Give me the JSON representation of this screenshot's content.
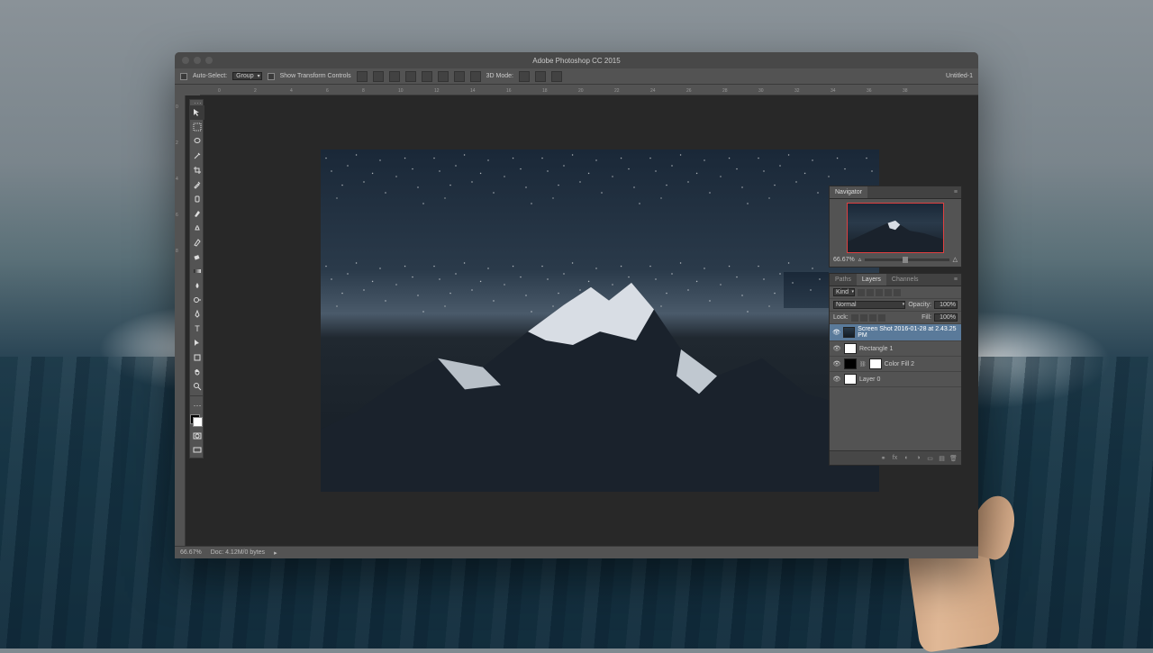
{
  "window": {
    "title": "Adobe Photoshop CC 2015",
    "doc_title": "Untitled-1"
  },
  "options": {
    "auto_select_label": "Auto-Select:",
    "auto_select_value": "Group",
    "show_transform_label": "Show Transform Controls",
    "mode_label": "3D Mode:"
  },
  "navigator": {
    "tab": "Navigator",
    "zoom": "66.67%"
  },
  "layers_panel": {
    "tabs": {
      "paths": "Paths",
      "layers": "Layers",
      "channels": "Channels"
    },
    "kind_label": "Kind",
    "blend_mode": "Normal",
    "opacity_label": "Opacity:",
    "opacity_value": "100%",
    "lock_label": "Lock:",
    "fill_label": "Fill:",
    "fill_value": "100%",
    "layers": [
      {
        "name": "Screen Shot 2016-01-28 at 2.43.25 PM",
        "selected": true,
        "thumb": "img"
      },
      {
        "name": "Rectangle 1",
        "selected": false,
        "thumb": "white"
      },
      {
        "name": "Color Fill 2",
        "selected": false,
        "thumb": "black",
        "mask": true
      },
      {
        "name": "Layer 0",
        "selected": false,
        "thumb": "white"
      }
    ]
  },
  "status": {
    "zoom": "66.67%",
    "doc_info": "Doc: 4.12M/0 bytes"
  }
}
